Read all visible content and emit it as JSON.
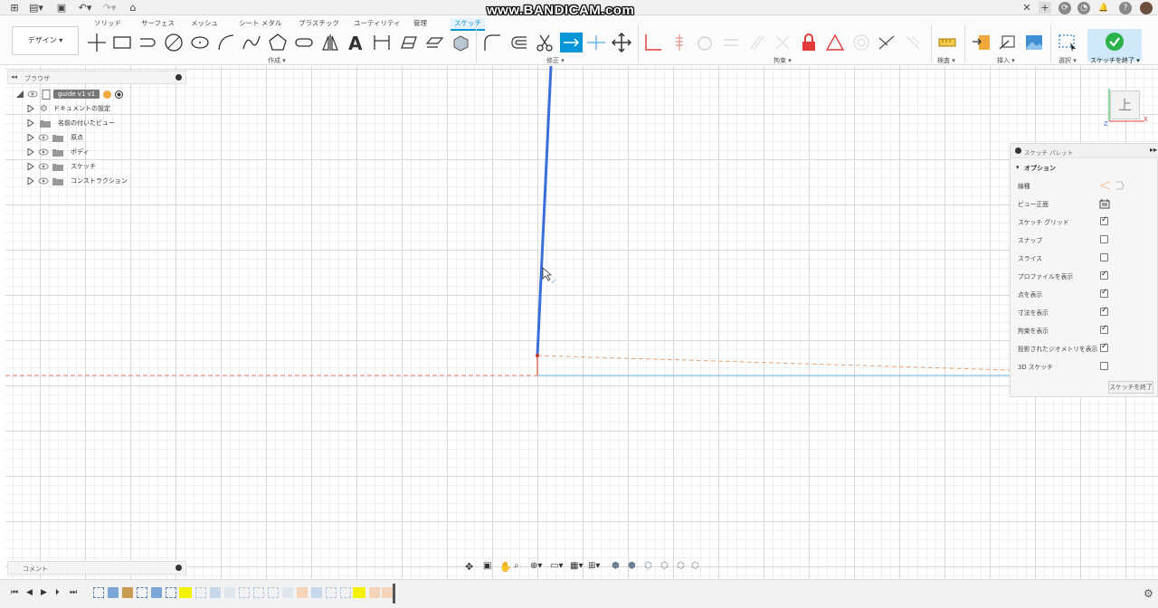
{
  "watermark": "www.BANDICAM.com",
  "ribbon": {
    "tabs": [
      "ソリッド",
      "サーフェス",
      "メッシュ",
      "シート メタル",
      "プラスチック",
      "ユーティリティ",
      "管理",
      "スケッチ"
    ],
    "active_tab": "スケッチ",
    "workspace_button": "デザイン ▾",
    "groups": {
      "create": "作成 ▾",
      "modify": "修正 ▾",
      "constraints": "拘束 ▾",
      "inspect": "検査 ▾",
      "insert": "挿入 ▾",
      "select": "選択 ▾",
      "finish": "スケッチを終了 ▾"
    }
  },
  "browser": {
    "title": "ブラウザ",
    "root": "guide v1 v1",
    "items": [
      "ドキュメントの設定",
      "名前の付いたビュー",
      "原点",
      "ボディ",
      "スケッチ",
      "コンストラクション"
    ]
  },
  "viewcube": {
    "face": "上"
  },
  "palette": {
    "title": "スケッチ パレット",
    "options_title": "オプション",
    "options": [
      {
        "label": "線種",
        "control": "linetype"
      },
      {
        "label": "ビュー正面",
        "control": "button"
      },
      {
        "label": "スケッチ グリッド",
        "checked": true
      },
      {
        "label": "スナップ",
        "checked": false
      },
      {
        "label": "スライス",
        "checked": false
      },
      {
        "label": "プロファイルを表示",
        "checked": true
      },
      {
        "label": "点を表示",
        "checked": true
      },
      {
        "label": "寸法を表示",
        "checked": true
      },
      {
        "label": "拘束を表示",
        "checked": true
      },
      {
        "label": "投影されたジオメトリを表示",
        "checked": true
      },
      {
        "label": "3D スケッチ",
        "checked": false
      }
    ],
    "finish_button": "スケッチを終了"
  },
  "comments": {
    "title": "コメント"
  },
  "colors": {
    "accent": "#0696d7",
    "sketch_line": "#3b6fd8",
    "axis_red": "#e07a5f",
    "axis_blue": "#6ab0de",
    "finish_green": "#2bb24c",
    "constraint_red": "#e23b3b",
    "timeline_highlight": "#f3f200"
  }
}
